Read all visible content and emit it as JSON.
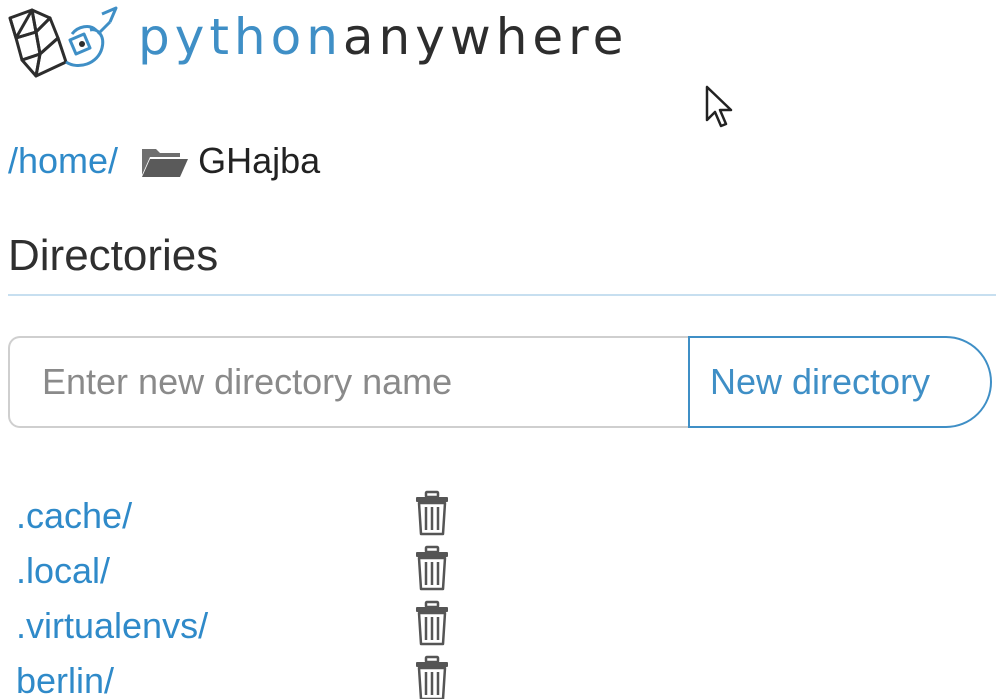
{
  "header": {
    "logo_python": "python",
    "logo_anywhere": "anywhere"
  },
  "breadcrumb": {
    "home_link": "/home/",
    "separator": "/",
    "current": "GHajba",
    "folder_icon": "folder-open-icon"
  },
  "directories": {
    "title": "Directories",
    "input_placeholder": "Enter new directory name",
    "input_value": "",
    "new_button_label": "New directory",
    "items": [
      {
        "label": ".cache/",
        "delete_icon": "trash-icon"
      },
      {
        "label": ".local/",
        "delete_icon": "trash-icon"
      },
      {
        "label": ".virtualenvs/",
        "delete_icon": "trash-icon"
      },
      {
        "label": "berlin/",
        "delete_icon": "trash-icon"
      }
    ]
  },
  "colors": {
    "link": "#2f8ac9",
    "brand_blue": "#3f8fc6",
    "text_dark": "#2d2d2d",
    "rule": "#c7dff0",
    "input_border": "#cfcfcf",
    "icon_gray": "#555555"
  }
}
